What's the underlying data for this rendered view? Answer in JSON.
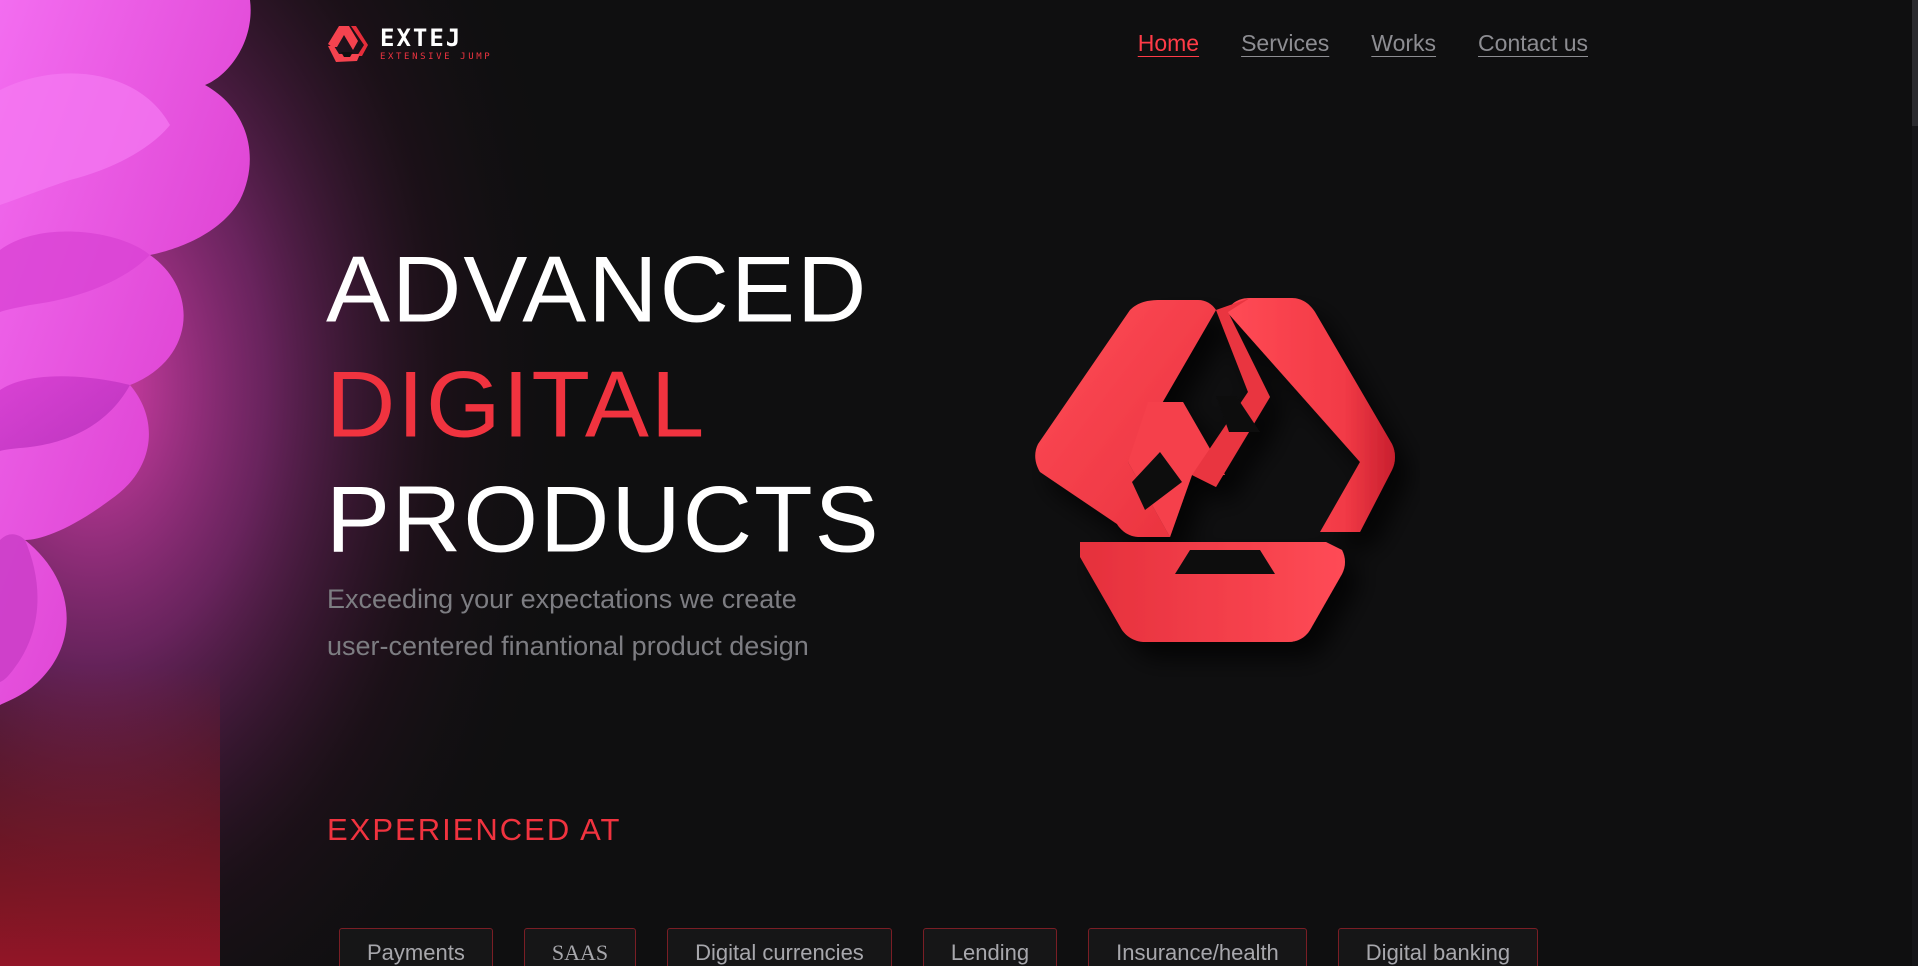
{
  "brand": {
    "name": "EXTEJ",
    "tagline": "EXTENSIVE JUMP",
    "accent_color": "#f0333f",
    "logo_icon": "triangle-ribbon-logo-icon"
  },
  "nav": {
    "items": [
      {
        "label": "Home",
        "active": true
      },
      {
        "label": "Services",
        "active": false
      },
      {
        "label": "Works",
        "active": false
      },
      {
        "label": "Contact us",
        "active": false
      }
    ]
  },
  "hero": {
    "line1": "ADVANCED",
    "line2": "DIGITAL",
    "line3": "PRODUCTS",
    "subtitle_line1": "Exceeding your expectations we create",
    "subtitle_line2": "user-centered finantional product design",
    "emblem_icon": "triangle-ribbon-emblem-icon"
  },
  "experience": {
    "title": "EXPERIENCED AT",
    "tags": [
      "Payments",
      "SAAS",
      "Digital currencies",
      "Lending",
      "Insurance/health",
      "Digital banking"
    ]
  },
  "colors": {
    "background": "#0f0f10",
    "blob": "#e845d8",
    "nav_text": "#8d8d92",
    "subtitle_text": "#7d7d82"
  }
}
